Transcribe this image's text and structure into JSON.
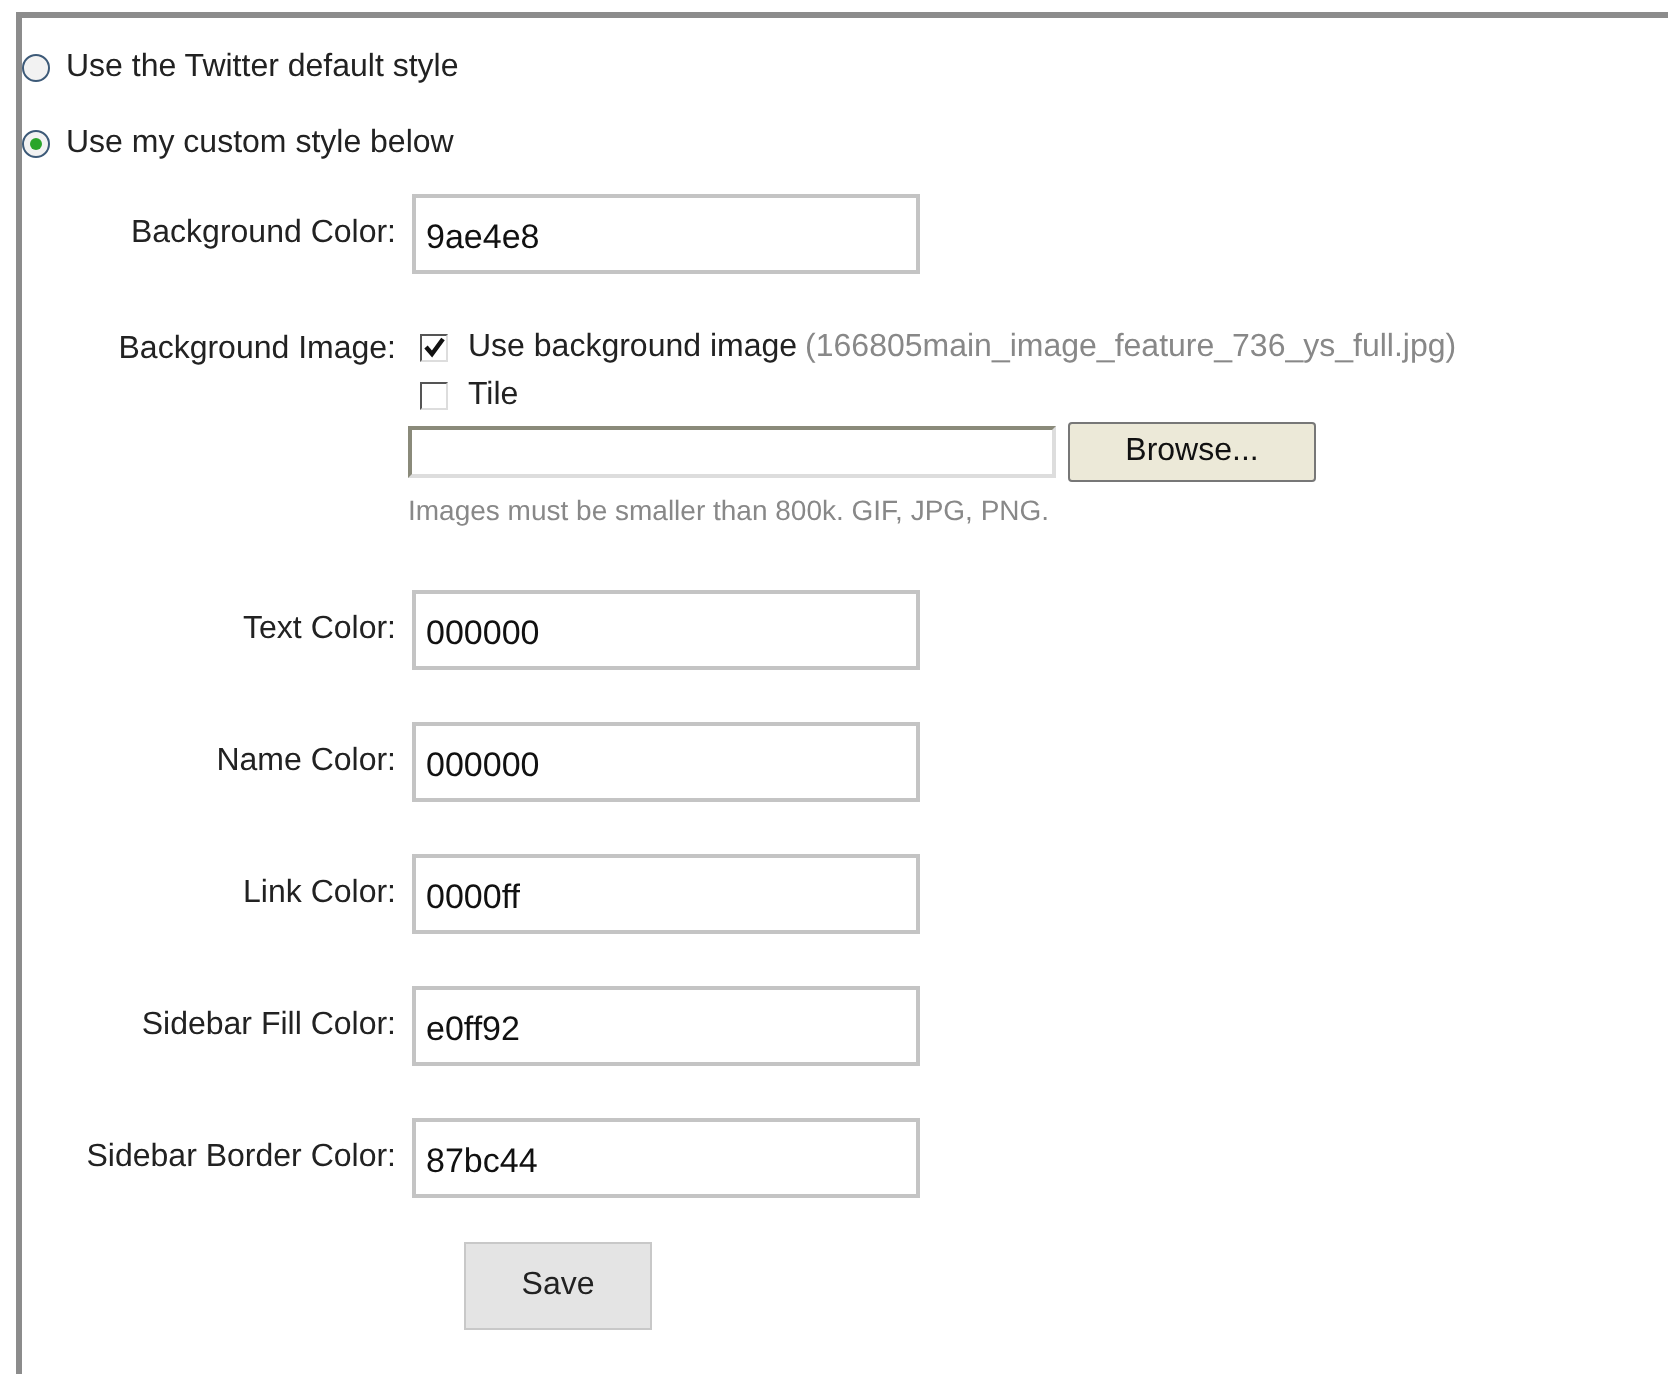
{
  "style_choice": [
    {
      "label": "Use the Twitter default style",
      "selected": false
    },
    {
      "label": "Use my custom style below",
      "selected": true
    }
  ],
  "background_color": {
    "label": "Background Color:",
    "value": "9ae4e8"
  },
  "background_image": {
    "label": "Background Image:",
    "options": [
      {
        "label": "Use background image",
        "note": "(166805main_image_feature_736_ys_full.jpg)",
        "checked": true
      },
      {
        "label": "Tile",
        "checked": false
      }
    ],
    "browse_button": "Browse...",
    "hint": "Images must be smaller than 800k. GIF, JPG, PNG."
  },
  "colors": [
    {
      "label": "Text Color:",
      "value": "000000"
    },
    {
      "label": "Name Color:",
      "value": "000000"
    },
    {
      "label": "Link Color:",
      "value": "0000ff"
    },
    {
      "label": "Sidebar Fill Color:",
      "value": "e0ff92"
    },
    {
      "label": "Sidebar Border Color:",
      "value": "87bc44"
    }
  ],
  "save_button": "Save"
}
